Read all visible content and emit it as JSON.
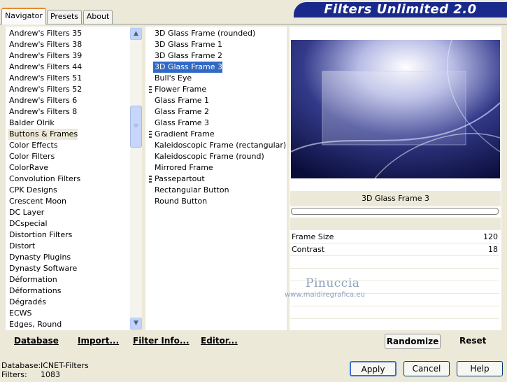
{
  "tabs": [
    "Navigator",
    "Presets",
    "About"
  ],
  "banner_title": "Filters Unlimited 2.0",
  "categories": [
    "Andrew's Filters 35",
    "Andrew's Filters 38",
    "Andrew's Filters 39",
    "Andrew's Filters 44",
    "Andrew's Filters 51",
    "Andrew's Filters 52",
    "Andrew's Filters 6",
    "Andrew's Filters 8",
    "Balder Olrik",
    "Buttons & Frames",
    "Color Effects",
    "Color Filters",
    "ColorRave",
    "Convolution Filters",
    "CPK Designs",
    "Crescent Moon",
    "DC Layer",
    "DCspecial",
    "Distortion Filters",
    "Distort",
    "Dynasty Plugins",
    "Dynasty Software",
    "Déformation",
    "Déformations",
    "Dégradés",
    "ECWS",
    "Edges, Round"
  ],
  "selected_category": "Buttons & Frames",
  "filters": [
    {
      "label": "3D Glass Frame (rounded)",
      "grip": false
    },
    {
      "label": "3D Glass Frame 1",
      "grip": false
    },
    {
      "label": "3D Glass Frame 2",
      "grip": false
    },
    {
      "label": "3D Glass Frame 3",
      "grip": false
    },
    {
      "label": "Bull's Eye",
      "grip": false
    },
    {
      "label": "Flower Frame",
      "grip": true
    },
    {
      "label": "Glass Frame 1",
      "grip": false
    },
    {
      "label": "Glass Frame 2",
      "grip": false
    },
    {
      "label": "Glass Frame 3",
      "grip": false
    },
    {
      "label": "Gradient Frame",
      "grip": true
    },
    {
      "label": "Kaleidoscopic Frame (rectangular)",
      "grip": false
    },
    {
      "label": "Kaleidoscopic Frame (round)",
      "grip": false
    },
    {
      "label": "Mirrored Frame",
      "grip": false
    },
    {
      "label": "Passepartout",
      "grip": true
    },
    {
      "label": "Rectangular Button",
      "grip": false
    },
    {
      "label": "Round Button",
      "grip": false
    }
  ],
  "selected_filter": "3D Glass Frame 3",
  "preview_filter_name": "3D Glass Frame 3",
  "params": [
    {
      "label": "Frame Size",
      "value": "120"
    },
    {
      "label": "Contrast",
      "value": "18"
    }
  ],
  "watermark": {
    "name": "Pinuccia",
    "url": "www.maidiregrafica.eu"
  },
  "bottom_links": {
    "database": "Database",
    "import": "Import...",
    "filter_info": "Filter Info...",
    "editor": "Editor..."
  },
  "randomize_label": "Randomize",
  "reset_label": "Reset",
  "status": {
    "database_label": "Database:",
    "database_value": "ICNET-Filters",
    "filters_label": "Filters:",
    "filters_value": "1083"
  },
  "dialog_buttons": {
    "apply": "Apply",
    "cancel": "Cancel",
    "help": "Help"
  },
  "icons": {
    "scroll_up": "chevron-up-icon",
    "scroll_down": "chevron-down-icon"
  },
  "colors": {
    "selection_blue": "#316ac5",
    "banner_blue": "#1a2a8c",
    "dialog_bg": "#ece9d8"
  }
}
